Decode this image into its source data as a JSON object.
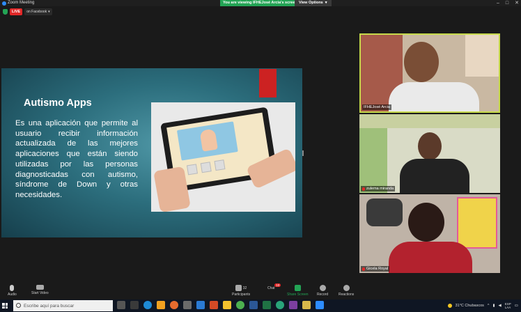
{
  "window": {
    "title": "Zoom Meeting"
  },
  "banner": {
    "viewing": "You are viewing IFHEJosé Arcia's screen",
    "view_options": "View Options"
  },
  "live": {
    "label": "LIVE",
    "platform": "on Facebook"
  },
  "slide": {
    "title": "Autismo Apps",
    "body": "Es una aplicación que permite al usuario recibir información actualizada de las mejores aplicaciones que están siendo utilizadas por las personas diagnosticadas con autismo, síndrome de Down y otras necesidades."
  },
  "participants": [
    {
      "name": "IFHEJosé Arcia"
    },
    {
      "name": "zulema miranda"
    },
    {
      "name": "Gicela Royal"
    }
  ],
  "toolbar": {
    "audio": "Audio",
    "start_video": "Start Video",
    "participants": "Participants",
    "participants_count": "32",
    "chat": "Chat",
    "chat_badge": "10",
    "share_screen": "Share Screen",
    "record": "Record",
    "reactions": "Reactions"
  },
  "taskbar": {
    "search_placeholder": "Escribe aquí para buscar",
    "weather": "31°C  Chubascos",
    "lang_top": "ESP",
    "lang_bottom": "LAA"
  },
  "colors": {
    "accent_green": "#23a455",
    "live_red": "#e02828",
    "active_border": "#c6d94a"
  }
}
